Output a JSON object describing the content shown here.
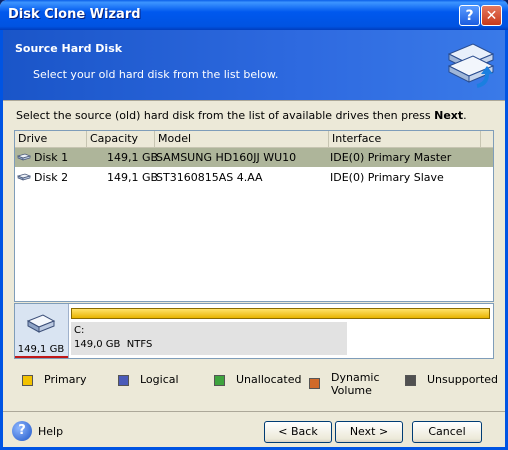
{
  "window": {
    "title": "Disk Clone Wizard",
    "help_glyph": "?",
    "close_glyph": "✕"
  },
  "header": {
    "title": "Source Hard Disk",
    "subtitle": "Select your old hard disk from the list below.",
    "icon": "hard-disk-copy-icon"
  },
  "instruction": {
    "text": "Select the source (old) hard disk from the list of available drives then press ",
    "bold": "Next",
    "end": "."
  },
  "table": {
    "columns": [
      "Drive",
      "Capacity",
      "Model",
      "Interface"
    ],
    "rows": [
      {
        "drive": "Disk 1",
        "capacity": "149,1 GB",
        "model": "SAMSUNG HD160JJ WU10",
        "interface": "IDE(0) Primary Master",
        "selected": true
      },
      {
        "drive": "Disk 2",
        "capacity": "149,1 GB",
        "model": "ST3160815AS 4.AA",
        "interface": "IDE(0) Primary Slave",
        "selected": false
      }
    ]
  },
  "disk_map": {
    "disk_size": "149,1 GB",
    "partition": {
      "letter": "C:",
      "size": "149,0 GB",
      "fs": "NTFS"
    },
    "bar_color": "#f2c200"
  },
  "legend": [
    {
      "label": "Primary",
      "color": "#f2c200"
    },
    {
      "label": "Logical",
      "color": "#4a5ab8"
    },
    {
      "label": "Unallocated",
      "color": "#3ea33e"
    },
    {
      "label": "Dynamic Volume",
      "line1": "Dynamic",
      "line2": "Volume",
      "color": "#d06a2a"
    },
    {
      "label": "Unsupported",
      "color": "#505050"
    }
  ],
  "footer": {
    "help_label": "Help",
    "back_label": "< Back",
    "next_label": "Next >",
    "cancel_label": "Cancel"
  }
}
